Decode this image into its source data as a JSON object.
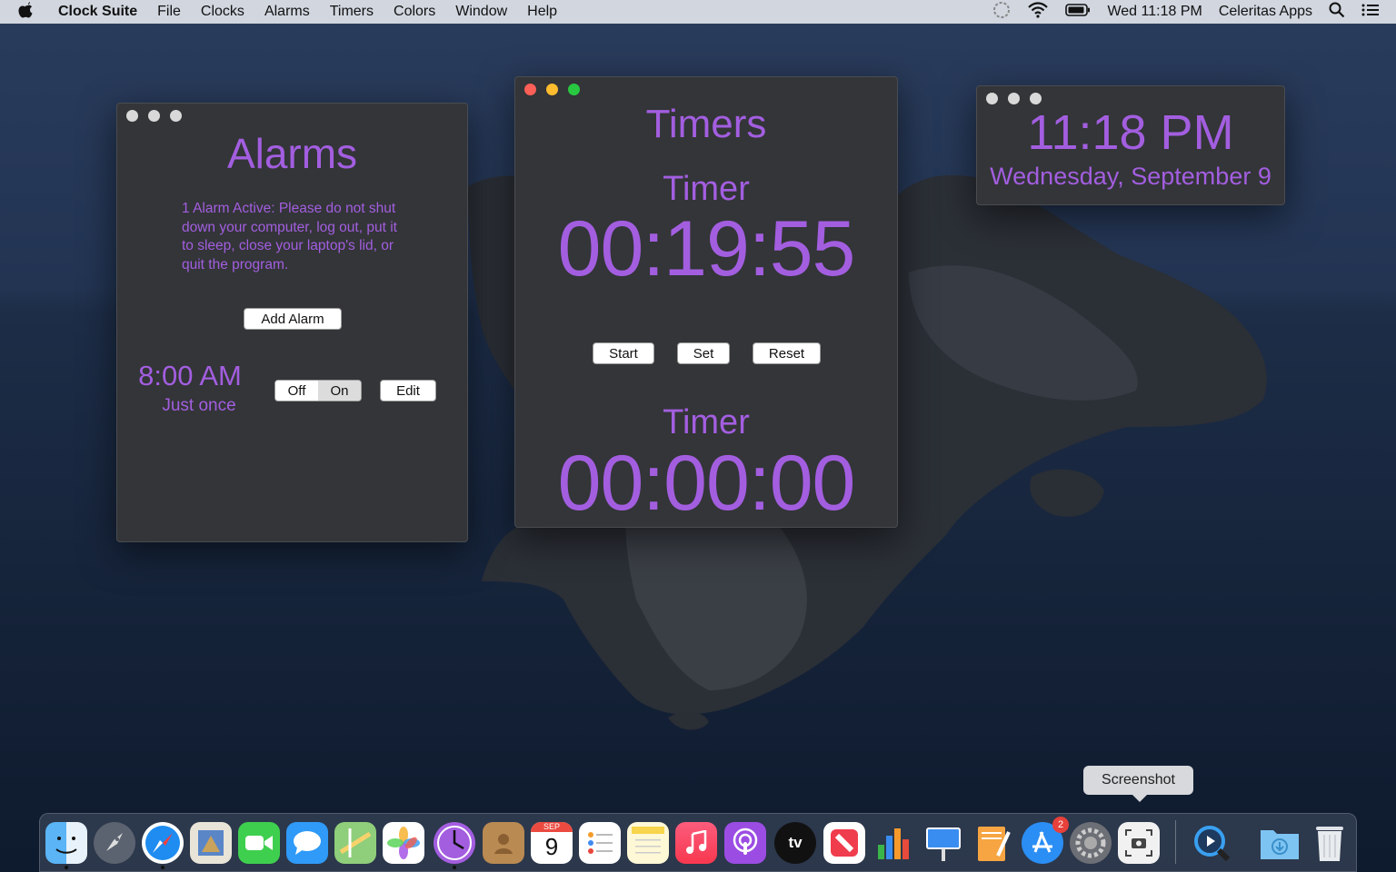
{
  "menubar": {
    "apple_icon": "apple-logo",
    "app_name": "Clock Suite",
    "menus": [
      "File",
      "Clocks",
      "Alarms",
      "Timers",
      "Colors",
      "Window",
      "Help"
    ],
    "datetime": "Wed 11:18 PM",
    "user": "Celeritas Apps",
    "status_icons": [
      "night-shift-icon",
      "wifi-icon",
      "battery-icon",
      "search-icon",
      "list-icon"
    ]
  },
  "alarms_window": {
    "title": "Alarms",
    "notice": "1 Alarm Active: Please do not shut down your computer, log out, put it to sleep, close your laptop's lid, or quit the program.",
    "add_button": "Add Alarm",
    "alarm": {
      "time": "8:00 AM",
      "repeat": "Just once",
      "toggle_off": "Off",
      "toggle_on": "On",
      "edit_button": "Edit"
    }
  },
  "timers_window": {
    "title": "Timers",
    "timer1": {
      "label": "Timer",
      "value": "00:19:55"
    },
    "buttons": {
      "start": "Start",
      "set": "Set",
      "reset": "Reset"
    },
    "timer2": {
      "label": "Timer",
      "value": "00:00:00"
    }
  },
  "clock_window": {
    "time": "11:18 PM",
    "date": "Wednesday, September 9"
  },
  "dock": {
    "tooltip": "Screenshot",
    "calendar_month": "SEP",
    "calendar_day": "9",
    "appstore_badge": "2",
    "tv_label": "tv",
    "items": [
      "finder-icon",
      "launchpad-icon",
      "safari-icon",
      "mail-icon",
      "facetime-icon",
      "messages-icon",
      "maps-icon",
      "photos-icon",
      "clock-suite-icon",
      "contacts-icon",
      "calendar-icon",
      "reminders-icon",
      "notes-icon",
      "music-icon",
      "podcasts-icon",
      "tv-icon",
      "news-icon",
      "numbers-icon",
      "keynote-icon",
      "pages-icon",
      "app-store-icon",
      "system-preferences-icon",
      "screenshot-icon",
      "quicktime-icon",
      "downloads-folder-icon",
      "trash-icon"
    ]
  },
  "colors": {
    "accent": "#a35ee0",
    "window_bg": "#333538",
    "close": "#fe5f57",
    "minimize": "#febc2e",
    "zoom": "#28c840"
  }
}
